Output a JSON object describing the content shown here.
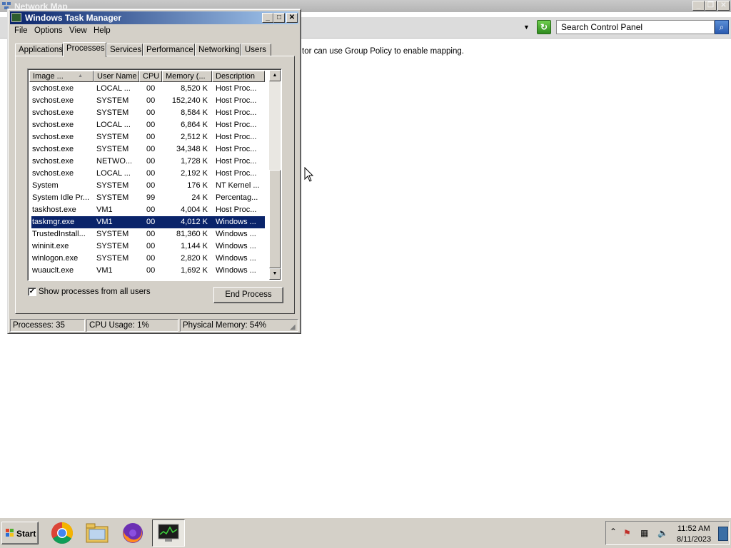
{
  "background_window": {
    "title": "Network Map",
    "search_placeholder": "Search Control Panel",
    "message": "tor can use Group Policy to enable mapping."
  },
  "task_manager": {
    "title": "Windows Task Manager",
    "menu": [
      "File",
      "Options",
      "View",
      "Help"
    ],
    "tabs": [
      "Applications",
      "Processes",
      "Services",
      "Performance",
      "Networking",
      "Users"
    ],
    "active_tab": "Processes",
    "columns": [
      "Image ...",
      "User Name",
      "CPU",
      "Memory (...",
      "Description"
    ],
    "processes": [
      {
        "image": "svchost.exe",
        "user": "LOCAL ...",
        "cpu": "00",
        "memory": "8,520 K",
        "description": "Host Proc..."
      },
      {
        "image": "svchost.exe",
        "user": "SYSTEM",
        "cpu": "00",
        "memory": "152,240 K",
        "description": "Host Proc..."
      },
      {
        "image": "svchost.exe",
        "user": "SYSTEM",
        "cpu": "00",
        "memory": "8,584 K",
        "description": "Host Proc..."
      },
      {
        "image": "svchost.exe",
        "user": "LOCAL ...",
        "cpu": "00",
        "memory": "6,864 K",
        "description": "Host Proc..."
      },
      {
        "image": "svchost.exe",
        "user": "SYSTEM",
        "cpu": "00",
        "memory": "2,512 K",
        "description": "Host Proc..."
      },
      {
        "image": "svchost.exe",
        "user": "SYSTEM",
        "cpu": "00",
        "memory": "34,348 K",
        "description": "Host Proc..."
      },
      {
        "image": "svchost.exe",
        "user": "NETWO...",
        "cpu": "00",
        "memory": "1,728 K",
        "description": "Host Proc..."
      },
      {
        "image": "svchost.exe",
        "user": "LOCAL ...",
        "cpu": "00",
        "memory": "2,192 K",
        "description": "Host Proc..."
      },
      {
        "image": "System",
        "user": "SYSTEM",
        "cpu": "00",
        "memory": "176 K",
        "description": "NT Kernel ..."
      },
      {
        "image": "System Idle Pr...",
        "user": "SYSTEM",
        "cpu": "99",
        "memory": "24 K",
        "description": "Percentag..."
      },
      {
        "image": "taskhost.exe",
        "user": "VM1",
        "cpu": "00",
        "memory": "4,004 K",
        "description": "Host Proc..."
      },
      {
        "image": "taskmgr.exe",
        "user": "VM1",
        "cpu": "00",
        "memory": "4,012 K",
        "description": "Windows ...",
        "selected": true
      },
      {
        "image": "TrustedInstall...",
        "user": "SYSTEM",
        "cpu": "00",
        "memory": "81,360 K",
        "description": "Windows ..."
      },
      {
        "image": "wininit.exe",
        "user": "SYSTEM",
        "cpu": "00",
        "memory": "1,144 K",
        "description": "Windows ..."
      },
      {
        "image": "winlogon.exe",
        "user": "SYSTEM",
        "cpu": "00",
        "memory": "2,820 K",
        "description": "Windows ..."
      },
      {
        "image": "wuauclt.exe",
        "user": "VM1",
        "cpu": "00",
        "memory": "1,692 K",
        "description": "Windows ..."
      }
    ],
    "show_all_users_label": "Show processes from all users",
    "show_all_users_checked": true,
    "end_process_label": "End Process",
    "status": {
      "processes": "Processes: 35",
      "cpu": "CPU Usage: 1%",
      "memory": "Physical Memory: 54%"
    }
  },
  "taskbar": {
    "start_label": "Start",
    "apps": [
      "chrome-icon",
      "file-explorer-icon",
      "firefox-icon",
      "task-manager-icon"
    ],
    "clock_time": "11:52 AM",
    "clock_date": "8/11/2023"
  }
}
